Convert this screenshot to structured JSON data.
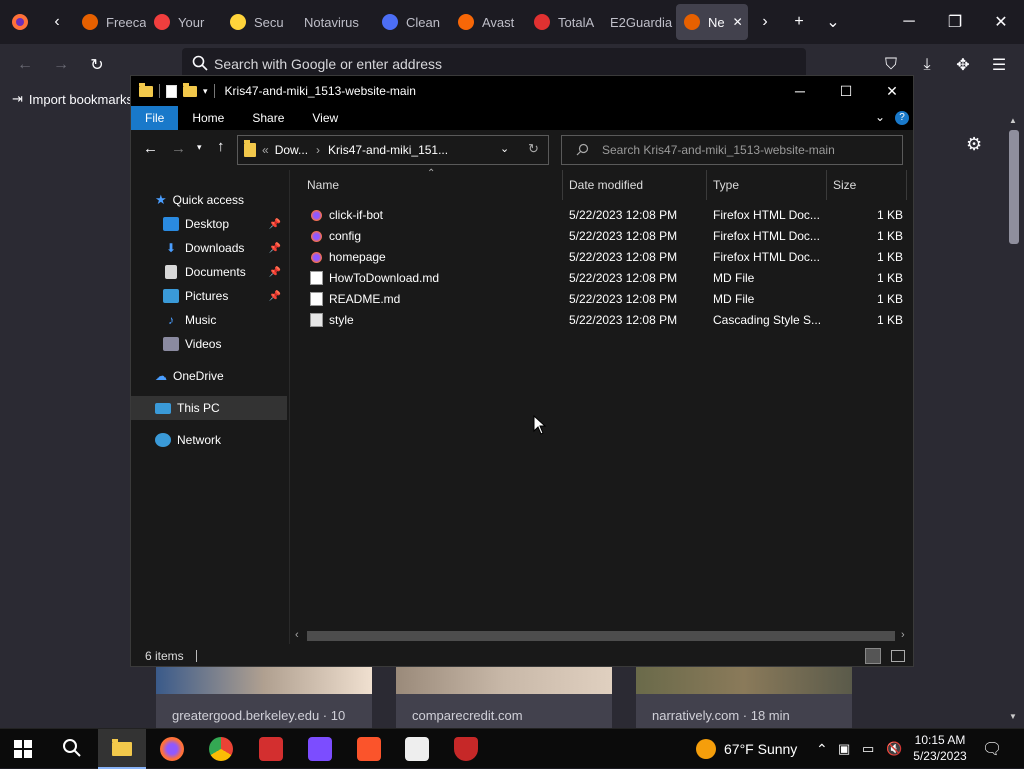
{
  "firefox": {
    "tabs": [
      {
        "label": "Freeca",
        "color": "#e66000"
      },
      {
        "label": "Your",
        "color": "#f03e3e"
      },
      {
        "label": "Secu",
        "color": "#ffd43b"
      },
      {
        "label": "Notavirus",
        "color": ""
      },
      {
        "label": "Clean",
        "color": "#4c6ef5"
      },
      {
        "label": "Avast",
        "color": "#f76707"
      },
      {
        "label": "TotalA",
        "color": "#e03131"
      },
      {
        "label": "E2Guardia",
        "color": ""
      },
      {
        "label": "Ne",
        "color": "#e66000"
      }
    ],
    "url_placeholder": "Search with Google or enter address",
    "bookmarks_label": "Import bookmarks...",
    "cards": [
      "greatergood.berkeley.edu · 10",
      "comparecredit.com",
      "narratively.com · 18 min"
    ]
  },
  "explorer": {
    "title": "Kris47-and-miki_1513-website-main",
    "ribbon_tabs": [
      "File",
      "Home",
      "Share",
      "View"
    ],
    "breadcrumb": [
      "Dow...",
      "Kris47-and-miki_151..."
    ],
    "search_placeholder": "Search Kris47-and-miki_1513-website-main",
    "nav": {
      "quick_access": "Quick access",
      "items": [
        "Desktop",
        "Downloads",
        "Documents",
        "Pictures",
        "Music",
        "Videos"
      ],
      "onedrive": "OneDrive",
      "this_pc": "This PC",
      "network": "Network"
    },
    "columns": [
      "Name",
      "Date modified",
      "Type",
      "Size"
    ],
    "files": [
      {
        "name": "click-if-bot",
        "date": "5/22/2023 12:08 PM",
        "type": "Firefox HTML Doc...",
        "size": "1 KB",
        "icon": "firefox-html"
      },
      {
        "name": "config",
        "date": "5/22/2023 12:08 PM",
        "type": "Firefox HTML Doc...",
        "size": "1 KB",
        "icon": "firefox-html"
      },
      {
        "name": "homepage",
        "date": "5/22/2023 12:08 PM",
        "type": "Firefox HTML Doc...",
        "size": "1 KB",
        "icon": "firefox-html"
      },
      {
        "name": "HowToDownload.md",
        "date": "5/22/2023 12:08 PM",
        "type": "MD File",
        "size": "1 KB",
        "icon": "md-file"
      },
      {
        "name": "README.md",
        "date": "5/22/2023 12:08 PM",
        "type": "MD File",
        "size": "1 KB",
        "icon": "md-file"
      },
      {
        "name": "style",
        "date": "5/22/2023 12:08 PM",
        "type": "Cascading Style S...",
        "size": "1 KB",
        "icon": "css-file"
      }
    ],
    "status": "6 items"
  },
  "taskbar": {
    "weather": "67°F  Sunny",
    "time": "10:15 AM",
    "date": "5/23/2023"
  }
}
